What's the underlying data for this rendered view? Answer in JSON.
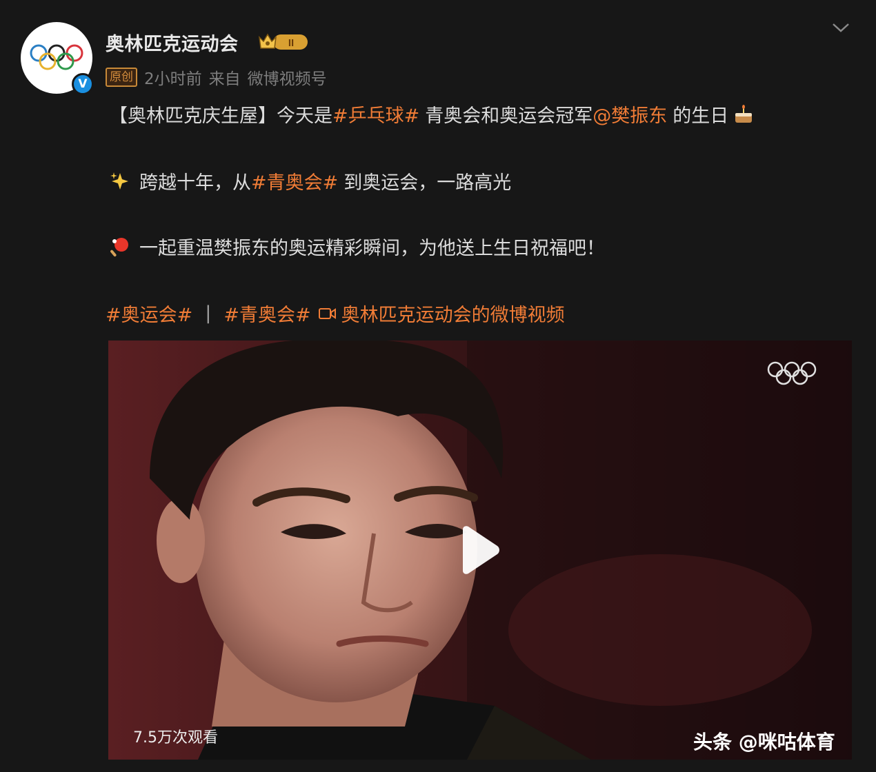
{
  "post": {
    "username": "奥林匹克运动会",
    "vip_level": "II",
    "original_tag": "原创",
    "time": "2小时前",
    "source_prefix": "来自",
    "source": "微博视频号"
  },
  "content": {
    "line1_prefix": "【奥林匹克庆生屋】今天是",
    "line1_tag": "#乒乓球#",
    "line1_mid": "青奥会和奥运会冠军",
    "line1_mention": "@樊振东",
    "line1_suffix": "的生日",
    "line2_text1": "跨越十年，从",
    "line2_tag": "#青奥会#",
    "line2_text2": "到奥运会，一路高光",
    "line3_text": "一起重温樊振东的奥运精彩瞬间，为他送上生日祝福吧！",
    "tags_line": {
      "tag1": "#奥运会#",
      "divider": "|",
      "tag2": "#青奥会#",
      "video_link": "奥林匹克运动会的微博视频"
    }
  },
  "video": {
    "views": "7.5万次观看"
  },
  "watermark": "头条 @咪咕体育",
  "colors": {
    "background": "#171717",
    "accent": "#f07c36",
    "verified": "#1a8fe0"
  },
  "icons": [
    "olympic-rings-icon",
    "verified-icon",
    "vip-crown-icon",
    "chevron-down-icon",
    "sparkles-icon",
    "ping-pong-icon",
    "cake-icon",
    "video-link-icon",
    "play-icon"
  ]
}
